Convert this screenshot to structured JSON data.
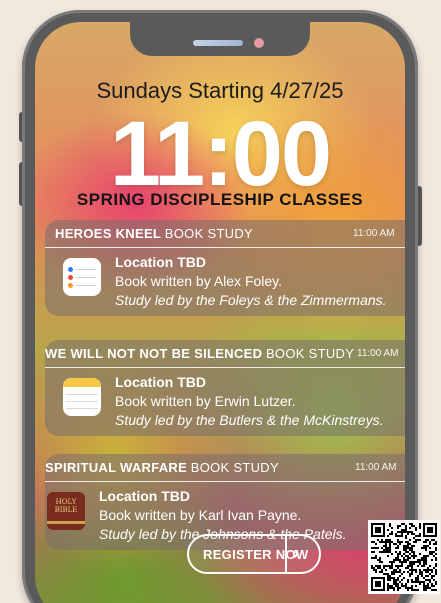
{
  "header": {
    "subtitle": "Sundays Starting 4/27/25",
    "time": "11:00",
    "classes_title": "SPRING DISCIPLESHIP CLASSES"
  },
  "notifications": [
    {
      "title_bold": "HEROES KNEEL",
      "title_light": "BOOK STUDY",
      "time": "11:00 AM",
      "icon": "reminders-icon",
      "location": "Location TBD",
      "author_line": "Book written by Alex Foley.",
      "led_line": "Study led by the Foleys & the Zimmermans."
    },
    {
      "title_bold": "WE WILL NOT NOT BE SILENCED",
      "title_light": "BOOK STUDY",
      "time": "11:00 AM",
      "icon": "notes-icon",
      "location": "Location TBD",
      "author_line": "Book written by Erwin Lutzer.",
      "led_line": "Study led by the Butlers & the McKinstreys."
    },
    {
      "title_bold": "SPIRITUAL WARFARE",
      "title_light": "BOOK STUDY",
      "time": "11:00 AM",
      "icon": "holy-bible-icon",
      "icon_text": "HOLY BIBLE",
      "location": "Location TBD",
      "author_line": "Book written by Karl Ivan Payne.",
      "led_line": "Study led by the Johnsons & the Patels."
    }
  ],
  "register": {
    "label": "REGISTER NOW",
    "chevron": "›"
  },
  "qr": {
    "icon": "qr-code"
  },
  "colors": {
    "card_bg": "rgba(120,110,110,0.55)",
    "phone_frame": "#5b5a5a",
    "background": "#f1e8de"
  }
}
